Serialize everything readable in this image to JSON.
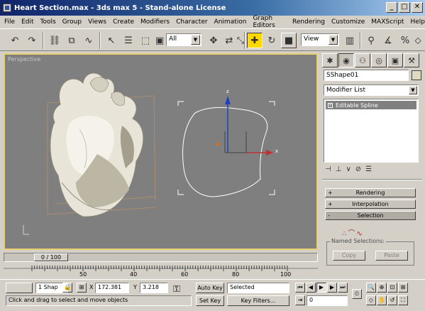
{
  "window": {
    "title": "Heart Section.max - 3ds max 5 - Stand-alone License",
    "minimize": "_",
    "maximize": "□",
    "close": "✕"
  },
  "menu": [
    "File",
    "Edit",
    "Tools",
    "Group",
    "Views",
    "Create",
    "Modifiers",
    "Character",
    "Animation",
    "Graph Editors",
    "Rendering",
    "Customize",
    "MAXScript",
    "Help"
  ],
  "toolbar": {
    "selection_filter": "All",
    "reference_coord": "View",
    "active_tool": "select-and-move"
  },
  "viewport": {
    "label": "Perspective",
    "border_color": "#e8d070",
    "axis_labels": {
      "x": "x",
      "z": "z"
    }
  },
  "command_panel": {
    "object_name": "SShape01",
    "modifier_list": "Modifier List",
    "stack_item": "Editable Spline",
    "rollouts": [
      {
        "sign": "+",
        "label": "Rendering"
      },
      {
        "sign": "+",
        "label": "Interpolation"
      },
      {
        "sign": "-",
        "label": "Selection"
      }
    ],
    "named_selections": {
      "label": "Named Selections:",
      "copy": "Copy",
      "paste": "Paste"
    }
  },
  "time_slider": {
    "label": "0 / 100",
    "ticks": [
      "50",
      "40",
      "60",
      "80",
      "100"
    ]
  },
  "status": {
    "selection_info": "1 Shap",
    "x_label": "X",
    "x_value": "172.381",
    "y_label": "Y",
    "y_value": "3.218",
    "auto_key": "Auto Key",
    "auto_key_mode": "Selected",
    "set_key": "Set Key",
    "key_filters": "Key Filters...",
    "frame": "0",
    "prompt": "Click and drag to select and move objects"
  },
  "colors": {
    "titlebar_start": "#10246a",
    "active_tool": "#ffd800",
    "viewport_bg": "#7f7f7f",
    "heart_fill": "#e8e4d8"
  }
}
